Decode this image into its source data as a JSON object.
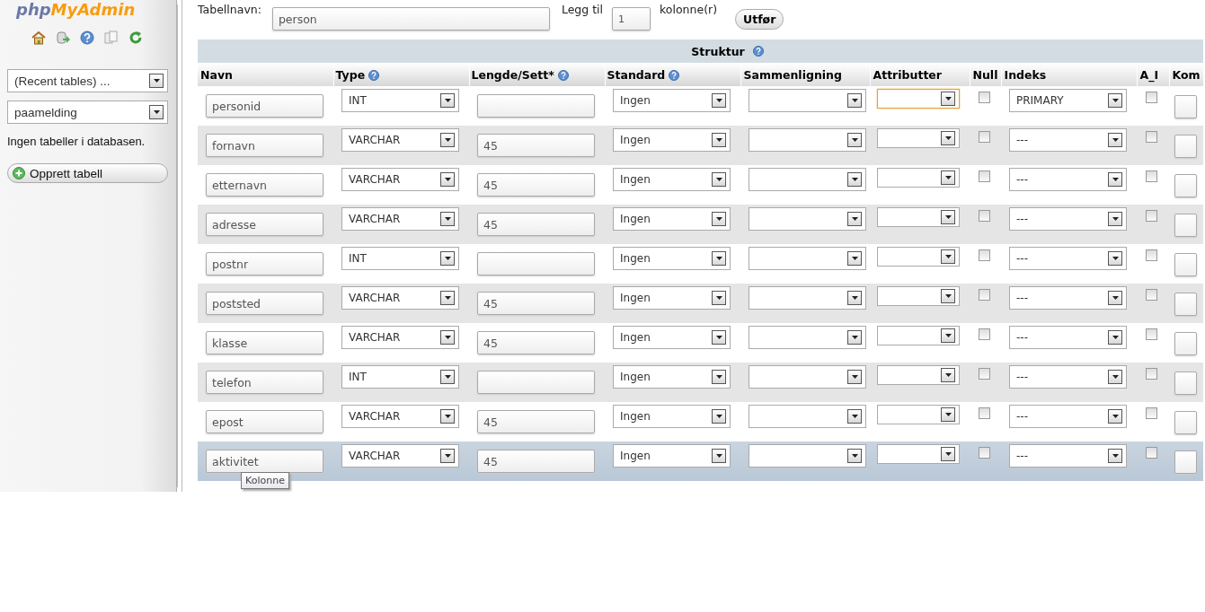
{
  "sidebar": {
    "logo": {
      "part1": "php",
      "part2": "MyAdmin"
    },
    "recent_tables": {
      "value": "(Recent tables) ..."
    },
    "database": {
      "value": "paamelding"
    },
    "message": "Ingen tabeller i databasen.",
    "create_button": "Opprett tabell"
  },
  "form": {
    "table_name_label": "Tabellnavn:",
    "table_name": "person",
    "add_label": "Legg til",
    "add_count": "1",
    "add_unit": "kolonne(r)",
    "go_button": "Utfør"
  },
  "table": {
    "title": "Struktur",
    "columns": [
      {
        "label": "Navn",
        "help": false
      },
      {
        "label": "Type",
        "help": true
      },
      {
        "label": "Lengde/Sett*",
        "help": true
      },
      {
        "label": "Standard",
        "help": true
      },
      {
        "label": "Sammenligning",
        "help": false
      },
      {
        "label": "Attributter",
        "help": false
      },
      {
        "label": "Null",
        "help": false
      },
      {
        "label": "Indeks",
        "help": false
      },
      {
        "label": "A_I",
        "help": false
      },
      {
        "label": "Kom",
        "help": false
      }
    ],
    "rows": [
      {
        "name": "personid",
        "type": "INT",
        "length": "",
        "default": "Ingen",
        "attributes_focused": true,
        "null": false,
        "index": "PRIMARY",
        "ai": false,
        "hovered": false
      },
      {
        "name": "fornavn",
        "type": "VARCHAR",
        "length": "45",
        "default": "Ingen",
        "attributes_focused": false,
        "null": false,
        "index": "---",
        "ai": false,
        "hovered": false
      },
      {
        "name": "etternavn",
        "type": "VARCHAR",
        "length": "45",
        "default": "Ingen",
        "attributes_focused": false,
        "null": false,
        "index": "---",
        "ai": false,
        "hovered": false
      },
      {
        "name": "adresse",
        "type": "VARCHAR",
        "length": "45",
        "default": "Ingen",
        "attributes_focused": false,
        "null": false,
        "index": "---",
        "ai": false,
        "hovered": false
      },
      {
        "name": "postnr",
        "type": "INT",
        "length": "",
        "default": "Ingen",
        "attributes_focused": false,
        "null": false,
        "index": "---",
        "ai": false,
        "hovered": false
      },
      {
        "name": "poststed",
        "type": "VARCHAR",
        "length": "45",
        "default": "Ingen",
        "attributes_focused": false,
        "null": false,
        "index": "---",
        "ai": false,
        "hovered": false
      },
      {
        "name": "klasse",
        "type": "VARCHAR",
        "length": "45",
        "default": "Ingen",
        "attributes_focused": false,
        "null": false,
        "index": "---",
        "ai": false,
        "hovered": false
      },
      {
        "name": "telefon",
        "type": "INT",
        "length": "",
        "default": "Ingen",
        "attributes_focused": false,
        "null": false,
        "index": "---",
        "ai": false,
        "hovered": false
      },
      {
        "name": "epost",
        "type": "VARCHAR",
        "length": "45",
        "default": "Ingen",
        "attributes_focused": false,
        "null": false,
        "index": "---",
        "ai": false,
        "hovered": false
      },
      {
        "name": "aktivitet",
        "type": "VARCHAR",
        "length": "45",
        "default": "Ingen",
        "attributes_focused": false,
        "null": false,
        "index": "---",
        "ai": false,
        "hovered": true
      }
    ]
  },
  "tooltip": "Kolonne"
}
